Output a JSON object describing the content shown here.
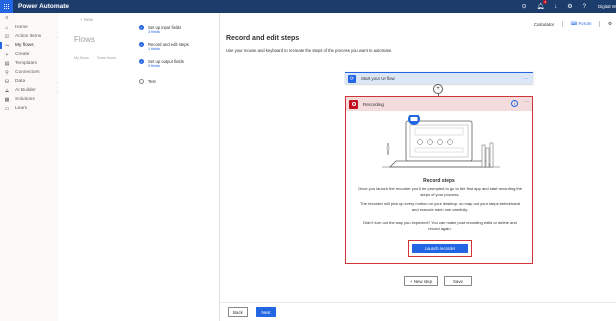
{
  "app": {
    "title": "Power Automate",
    "environment": "Digital W"
  },
  "topbar": {
    "notification_count": "4"
  },
  "nav": {
    "items": [
      {
        "label": "Home",
        "icon": "home-icon",
        "glyph": "⌂",
        "chevron": false
      },
      {
        "label": "Action items",
        "icon": "checklist-icon",
        "glyph": "☑",
        "chevron": true
      },
      {
        "label": "My flows",
        "icon": "flow-icon",
        "glyph": "⤳",
        "chevron": false,
        "active": true
      },
      {
        "label": "Create",
        "icon": "plus-icon",
        "glyph": "+",
        "chevron": false
      },
      {
        "label": "Templates",
        "icon": "template-icon",
        "glyph": "▤",
        "chevron": false
      },
      {
        "label": "Connectors",
        "icon": "connector-icon",
        "glyph": "⚲",
        "chevron": false
      },
      {
        "label": "Data",
        "icon": "database-icon",
        "glyph": "⛁",
        "chevron": true
      },
      {
        "label": "AI Builder",
        "icon": "ai-builder-icon",
        "glyph": "⟁",
        "chevron": true
      },
      {
        "label": "Solutions",
        "icon": "solutions-icon",
        "glyph": "▦",
        "chevron": false
      },
      {
        "label": "Learn",
        "icon": "book-icon",
        "glyph": "▭",
        "chevron": false
      }
    ]
  },
  "flows_page": {
    "new_label": "New",
    "title": "Flows",
    "tabs": [
      "My flows",
      "Team flows"
    ]
  },
  "wizard": {
    "steps": [
      {
        "title": "Set up input fields",
        "sub": "3 fields",
        "done": true
      },
      {
        "title": "Record and edit steps",
        "sub": "1 fields",
        "done": true
      },
      {
        "title": "Set up output fields",
        "sub": "0 fields",
        "done": true
      },
      {
        "title": "Test",
        "sub": "",
        "done": false
      }
    ]
  },
  "main": {
    "tools": {
      "calculator": "Calculator",
      "forum": "Forum"
    },
    "heading": "Record and edit steps",
    "description": "Use your mouse and keyboard to recreate the steps of the process you want to automate.",
    "start_card": {
      "label": "Start your UI flow"
    },
    "recording_card": {
      "label": "Recording",
      "title": "Record steps",
      "para1": "Once you launch the recorder you'll be prompted to go to the first app and start recording the steps of your process.",
      "para2": "The recorder will pick up every motion on your desktop, so map out your steps beforehand and execute each one carefully.",
      "para3": "Didn't turn out the way you expected? You can make post recording edits or delete and record again.",
      "launch_label": "Launch recorder"
    },
    "new_step_label": "+ New step",
    "save_label": "Save",
    "back_label": "Back",
    "next_label": "Next"
  },
  "colors": {
    "brand": "#2266e3",
    "topbar": "#1c3d6b",
    "danger": "#d13438"
  }
}
